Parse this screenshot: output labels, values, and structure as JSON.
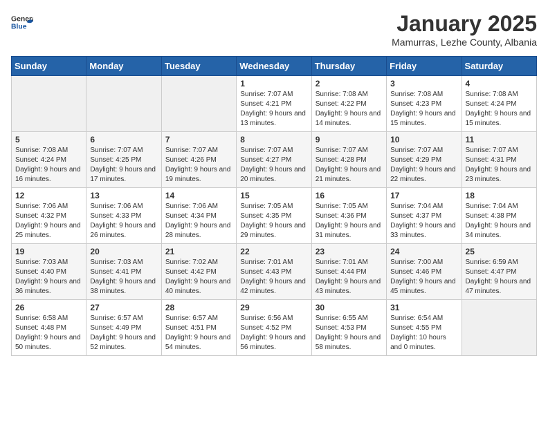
{
  "header": {
    "logo_general": "General",
    "logo_blue": "Blue",
    "title": "January 2025",
    "subtitle": "Mamurras, Lezhe County, Albania"
  },
  "calendar": {
    "days_of_week": [
      "Sunday",
      "Monday",
      "Tuesday",
      "Wednesday",
      "Thursday",
      "Friday",
      "Saturday"
    ],
    "weeks": [
      [
        {
          "day": "",
          "sunrise": "",
          "sunset": "",
          "daylight": ""
        },
        {
          "day": "",
          "sunrise": "",
          "sunset": "",
          "daylight": ""
        },
        {
          "day": "",
          "sunrise": "",
          "sunset": "",
          "daylight": ""
        },
        {
          "day": "1",
          "sunrise": "7:07 AM",
          "sunset": "4:21 PM",
          "daylight": "9 hours and 13 minutes."
        },
        {
          "day": "2",
          "sunrise": "7:08 AM",
          "sunset": "4:22 PM",
          "daylight": "9 hours and 14 minutes."
        },
        {
          "day": "3",
          "sunrise": "7:08 AM",
          "sunset": "4:23 PM",
          "daylight": "9 hours and 15 minutes."
        },
        {
          "day": "4",
          "sunrise": "7:08 AM",
          "sunset": "4:24 PM",
          "daylight": "9 hours and 15 minutes."
        }
      ],
      [
        {
          "day": "5",
          "sunrise": "7:08 AM",
          "sunset": "4:24 PM",
          "daylight": "9 hours and 16 minutes."
        },
        {
          "day": "6",
          "sunrise": "7:07 AM",
          "sunset": "4:25 PM",
          "daylight": "9 hours and 17 minutes."
        },
        {
          "day": "7",
          "sunrise": "7:07 AM",
          "sunset": "4:26 PM",
          "daylight": "9 hours and 19 minutes."
        },
        {
          "day": "8",
          "sunrise": "7:07 AM",
          "sunset": "4:27 PM",
          "daylight": "9 hours and 20 minutes."
        },
        {
          "day": "9",
          "sunrise": "7:07 AM",
          "sunset": "4:28 PM",
          "daylight": "9 hours and 21 minutes."
        },
        {
          "day": "10",
          "sunrise": "7:07 AM",
          "sunset": "4:29 PM",
          "daylight": "9 hours and 22 minutes."
        },
        {
          "day": "11",
          "sunrise": "7:07 AM",
          "sunset": "4:31 PM",
          "daylight": "9 hours and 23 minutes."
        }
      ],
      [
        {
          "day": "12",
          "sunrise": "7:06 AM",
          "sunset": "4:32 PM",
          "daylight": "9 hours and 25 minutes."
        },
        {
          "day": "13",
          "sunrise": "7:06 AM",
          "sunset": "4:33 PM",
          "daylight": "9 hours and 26 minutes."
        },
        {
          "day": "14",
          "sunrise": "7:06 AM",
          "sunset": "4:34 PM",
          "daylight": "9 hours and 28 minutes."
        },
        {
          "day": "15",
          "sunrise": "7:05 AM",
          "sunset": "4:35 PM",
          "daylight": "9 hours and 29 minutes."
        },
        {
          "day": "16",
          "sunrise": "7:05 AM",
          "sunset": "4:36 PM",
          "daylight": "9 hours and 31 minutes."
        },
        {
          "day": "17",
          "sunrise": "7:04 AM",
          "sunset": "4:37 PM",
          "daylight": "9 hours and 33 minutes."
        },
        {
          "day": "18",
          "sunrise": "7:04 AM",
          "sunset": "4:38 PM",
          "daylight": "9 hours and 34 minutes."
        }
      ],
      [
        {
          "day": "19",
          "sunrise": "7:03 AM",
          "sunset": "4:40 PM",
          "daylight": "9 hours and 36 minutes."
        },
        {
          "day": "20",
          "sunrise": "7:03 AM",
          "sunset": "4:41 PM",
          "daylight": "9 hours and 38 minutes."
        },
        {
          "day": "21",
          "sunrise": "7:02 AM",
          "sunset": "4:42 PM",
          "daylight": "9 hours and 40 minutes."
        },
        {
          "day": "22",
          "sunrise": "7:01 AM",
          "sunset": "4:43 PM",
          "daylight": "9 hours and 42 minutes."
        },
        {
          "day": "23",
          "sunrise": "7:01 AM",
          "sunset": "4:44 PM",
          "daylight": "9 hours and 43 minutes."
        },
        {
          "day": "24",
          "sunrise": "7:00 AM",
          "sunset": "4:46 PM",
          "daylight": "9 hours and 45 minutes."
        },
        {
          "day": "25",
          "sunrise": "6:59 AM",
          "sunset": "4:47 PM",
          "daylight": "9 hours and 47 minutes."
        }
      ],
      [
        {
          "day": "26",
          "sunrise": "6:58 AM",
          "sunset": "4:48 PM",
          "daylight": "9 hours and 50 minutes."
        },
        {
          "day": "27",
          "sunrise": "6:57 AM",
          "sunset": "4:49 PM",
          "daylight": "9 hours and 52 minutes."
        },
        {
          "day": "28",
          "sunrise": "6:57 AM",
          "sunset": "4:51 PM",
          "daylight": "9 hours and 54 minutes."
        },
        {
          "day": "29",
          "sunrise": "6:56 AM",
          "sunset": "4:52 PM",
          "daylight": "9 hours and 56 minutes."
        },
        {
          "day": "30",
          "sunrise": "6:55 AM",
          "sunset": "4:53 PM",
          "daylight": "9 hours and 58 minutes."
        },
        {
          "day": "31",
          "sunrise": "6:54 AM",
          "sunset": "4:55 PM",
          "daylight": "10 hours and 0 minutes."
        },
        {
          "day": "",
          "sunrise": "",
          "sunset": "",
          "daylight": ""
        }
      ]
    ]
  }
}
